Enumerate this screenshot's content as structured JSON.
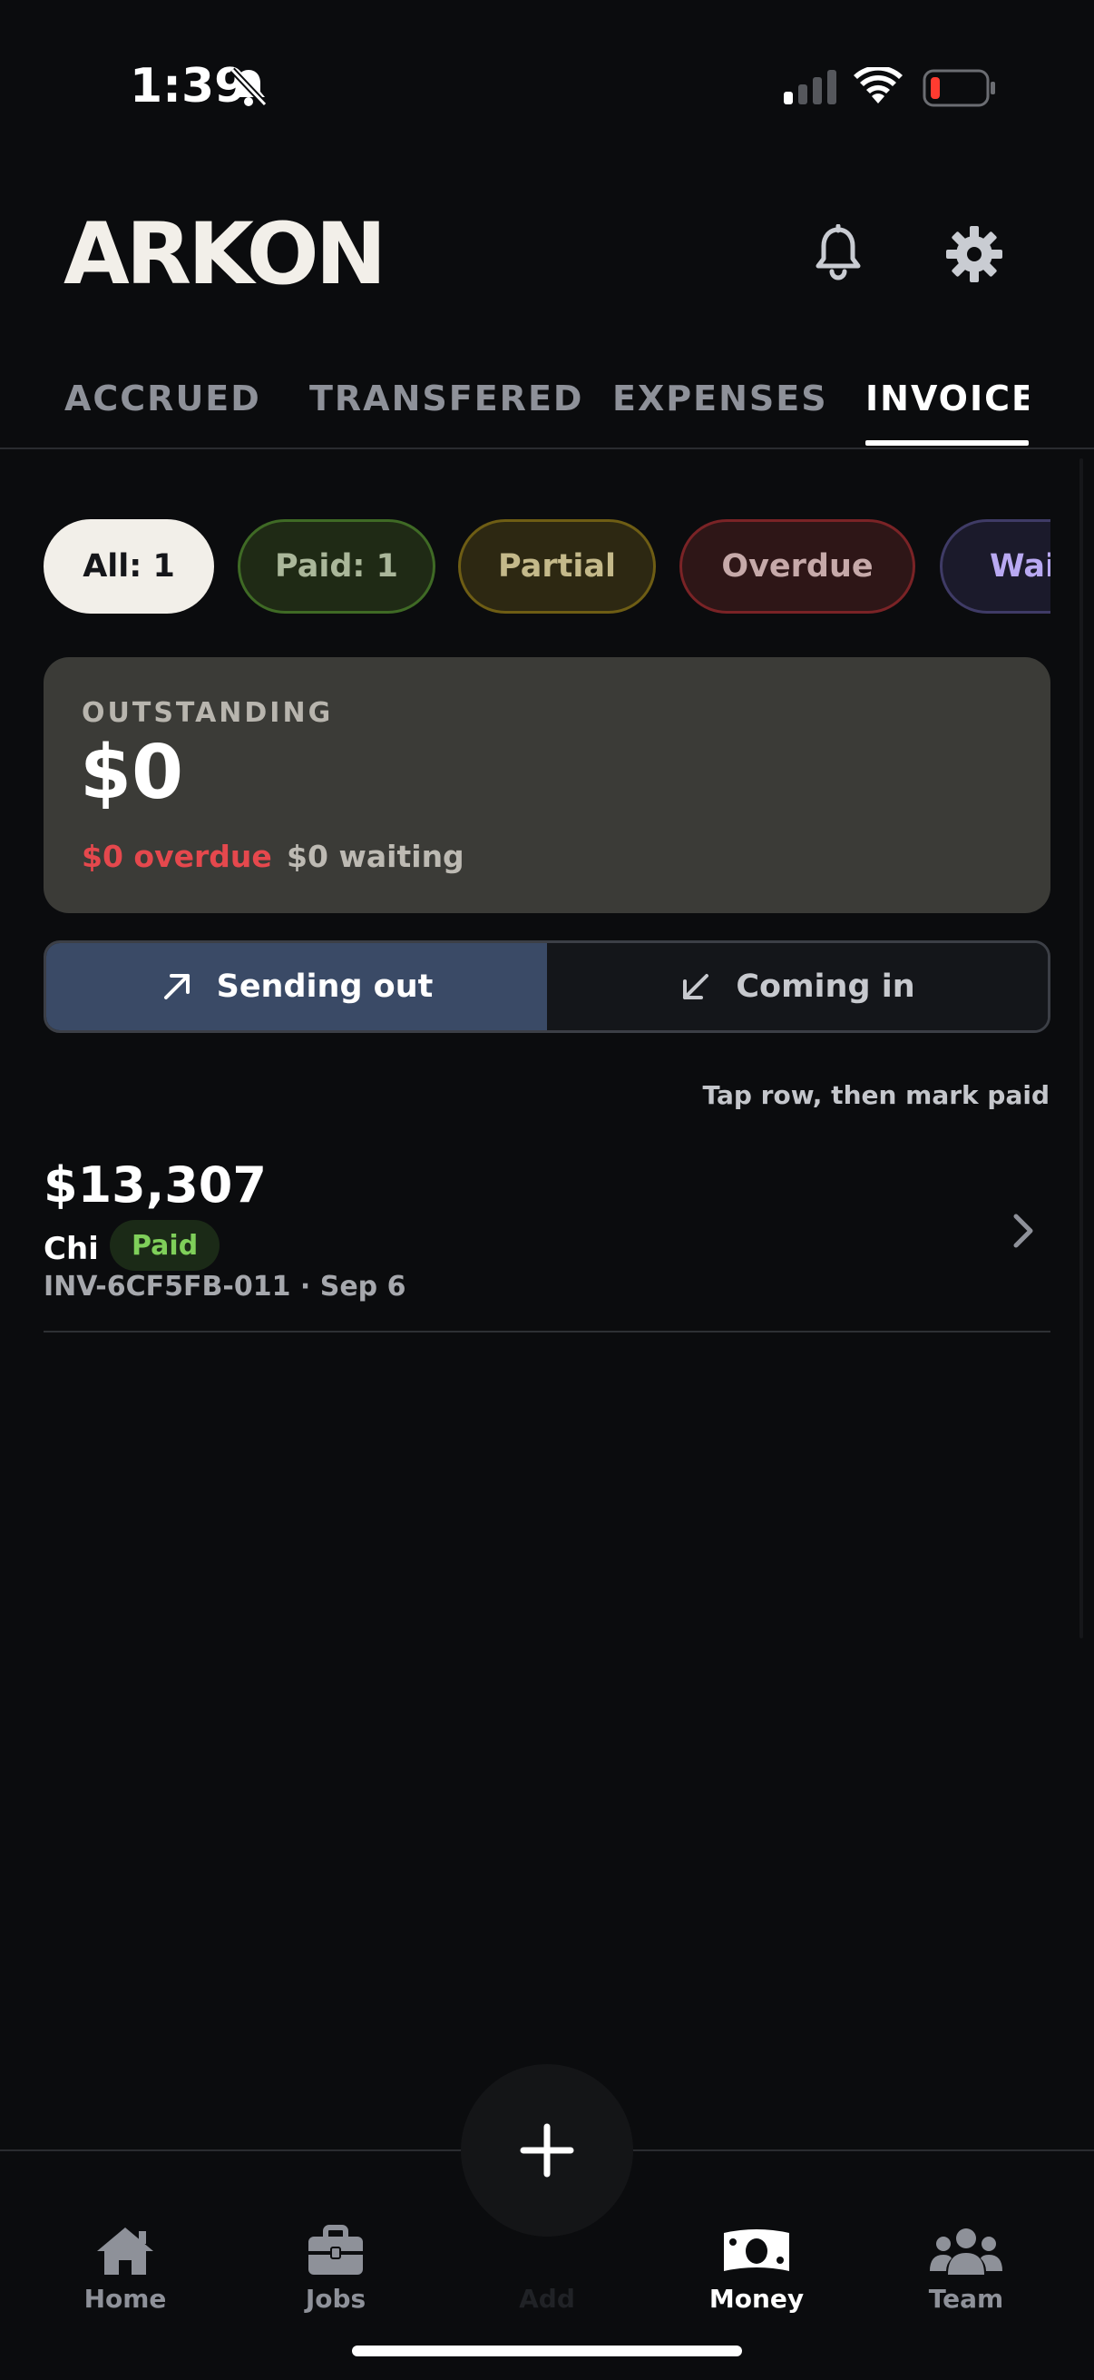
{
  "status_bar": {
    "time": "1:39"
  },
  "header": {
    "logo": "ARKON"
  },
  "tabs": [
    {
      "label": "ACCRUED"
    },
    {
      "label": "TRANSFERED"
    },
    {
      "label": "EXPENSES"
    },
    {
      "label": "INVOICES"
    }
  ],
  "filters": {
    "all": "All: 1",
    "paid": "Paid: 1",
    "partial": "Partial",
    "overdue": "Overdue",
    "waiting": "Waiting"
  },
  "outstanding": {
    "label": "OUTSTANDING",
    "amount": "$0",
    "overdue": "$0 overdue",
    "waiting": "$0 waiting"
  },
  "direction": {
    "out_label": "Sending out",
    "in_label": "Coming in"
  },
  "hint": "Tap row, then mark paid",
  "invoices": [
    {
      "amount": "$13,307",
      "client": "Chi",
      "status": "Paid",
      "meta": "INV-6CF5FB-011 · Sep 6"
    }
  ],
  "nav": {
    "home": "Home",
    "jobs": "Jobs",
    "add": "Add",
    "money": "Money",
    "team": "Team"
  },
  "colors": {
    "background": "#0b0c0e",
    "accent_out": "#3a4a66",
    "overdue_red": "#e5484d",
    "paid_green": "#7fcf5a"
  }
}
